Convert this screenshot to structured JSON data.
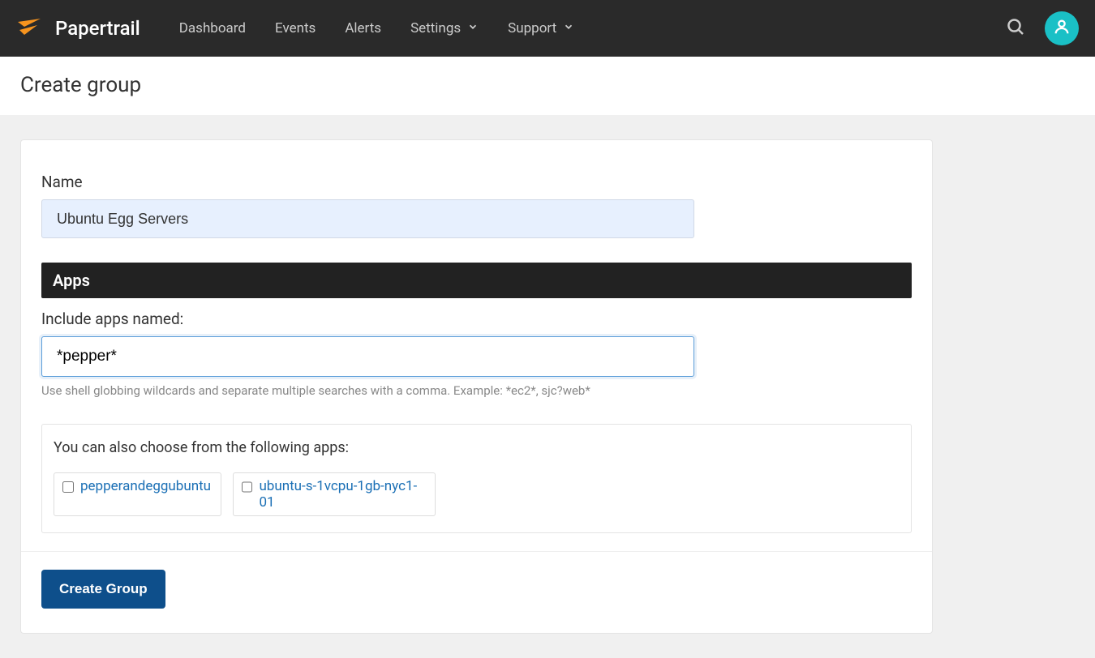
{
  "nav": {
    "brand": "Papertrail",
    "items": [
      {
        "label": "Dashboard",
        "dropdown": false
      },
      {
        "label": "Events",
        "dropdown": false
      },
      {
        "label": "Alerts",
        "dropdown": false
      },
      {
        "label": "Settings",
        "dropdown": true
      },
      {
        "label": "Support",
        "dropdown": true
      }
    ]
  },
  "page": {
    "title": "Create group"
  },
  "form": {
    "name_label": "Name",
    "name_value": "Ubuntu Egg Servers",
    "apps_section": "Apps",
    "include_label": "Include apps named:",
    "include_value": "*pepper*",
    "include_help": "Use shell globbing wildcards and separate multiple searches with a comma. Example: *ec2*, sjc?web*",
    "choose_label": "You can also choose from the following apps:",
    "apps": [
      {
        "label": "pepperandeggubuntu",
        "checked": false
      },
      {
        "label": "ubuntu-s-1vcpu-1gb-nyc1-01",
        "checked": false
      }
    ],
    "submit_label": "Create Group"
  },
  "colors": {
    "accent": "#0e4f8b",
    "link": "#1a6fb5",
    "avatar": "#1ac0c6",
    "logo": "#f7941e"
  }
}
